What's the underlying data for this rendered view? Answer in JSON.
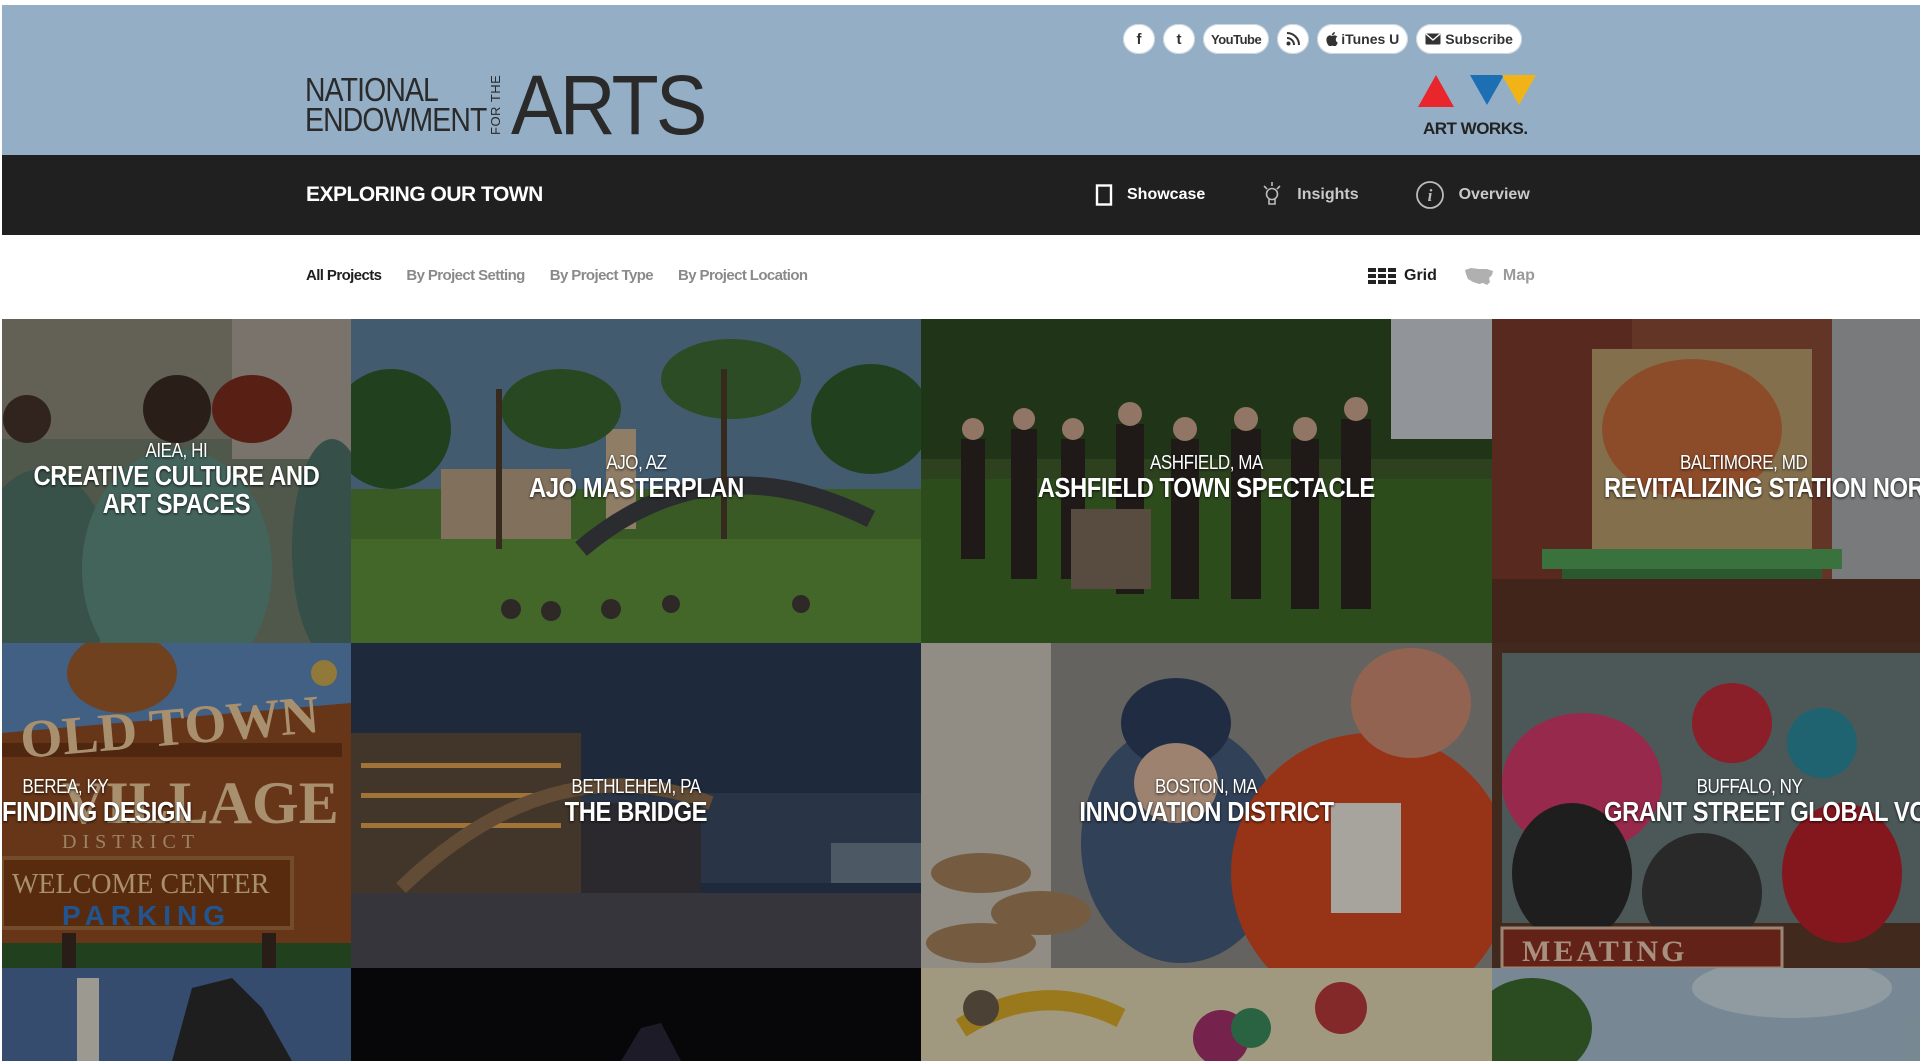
{
  "header": {
    "logo": {
      "line1": "NATIONAL",
      "line2": "ENDOWMENT",
      "for_the": "FOR THE",
      "arts": "ARTS"
    },
    "social": [
      {
        "icon": "facebook-icon",
        "glyph": "f",
        "label": ""
      },
      {
        "icon": "twitter-icon",
        "glyph": "t",
        "label": ""
      },
      {
        "icon": "youtube-icon",
        "glyph": "",
        "label": "YouTube"
      },
      {
        "icon": "rss-icon",
        "glyph": "◔",
        "label": ""
      },
      {
        "icon": "apple-icon",
        "glyph": "",
        "label": "iTunes U"
      },
      {
        "icon": "mail-icon",
        "glyph": "✉",
        "label": "Subscribe"
      }
    ],
    "art_works": "ART WORKS.",
    "art_works_colors": {
      "red": "#e8262c",
      "blue": "#1c6fb3",
      "yellow": "#f2b316"
    }
  },
  "nav": {
    "section_title": "EXPLORING OUR TOWN",
    "tabs": [
      {
        "label": "Showcase",
        "icon": "showcase-icon",
        "active": true
      },
      {
        "label": "Insights",
        "icon": "lightbulb-icon",
        "active": false
      },
      {
        "label": "Overview",
        "icon": "info-icon",
        "active": false
      }
    ]
  },
  "filters": {
    "items": [
      {
        "label": "All Projects",
        "active": true
      },
      {
        "label": "By Project Setting",
        "active": false
      },
      {
        "label": "By Project Type",
        "active": false
      },
      {
        "label": "By Project Location",
        "active": false
      }
    ],
    "views": [
      {
        "label": "Grid",
        "icon": "grid-icon",
        "active": true
      },
      {
        "label": "Map",
        "icon": "usa-map-icon",
        "active": false
      }
    ]
  },
  "projects": [
    {
      "location": "AIEA, HI",
      "name": "CREATIVE CULTURE AND ART SPACES"
    },
    {
      "location": "AJO, AZ",
      "name": "AJO MASTERPLAN"
    },
    {
      "location": "ASHFIELD, MA",
      "name": "ASHFIELD TOWN SPECTACLE"
    },
    {
      "location": "BALTIMORE, MD",
      "name": "REVITALIZING STATION NORT"
    },
    {
      "location": "BEREA, KY",
      "name": "FINDING DESIGN"
    },
    {
      "location": "BETHLEHEM, PA",
      "name": "THE BRIDGE"
    },
    {
      "location": "BOSTON, MA",
      "name": "INNOVATION DISTRICT"
    },
    {
      "location": "BUFFALO, NY",
      "name": "GRANT STREET GLOBAL VOIC"
    },
    {
      "location": "",
      "name": ""
    },
    {
      "location": "",
      "name": ""
    },
    {
      "location": "",
      "name": ""
    },
    {
      "location": "",
      "name": ""
    }
  ],
  "sign_text": {
    "old_town": "OLD TOWN",
    "village": "VILLAGE",
    "district": "DISTRICT",
    "welcome": "WELCOME CENTER",
    "parking": "PARKING"
  },
  "mural_text": "MEATING"
}
